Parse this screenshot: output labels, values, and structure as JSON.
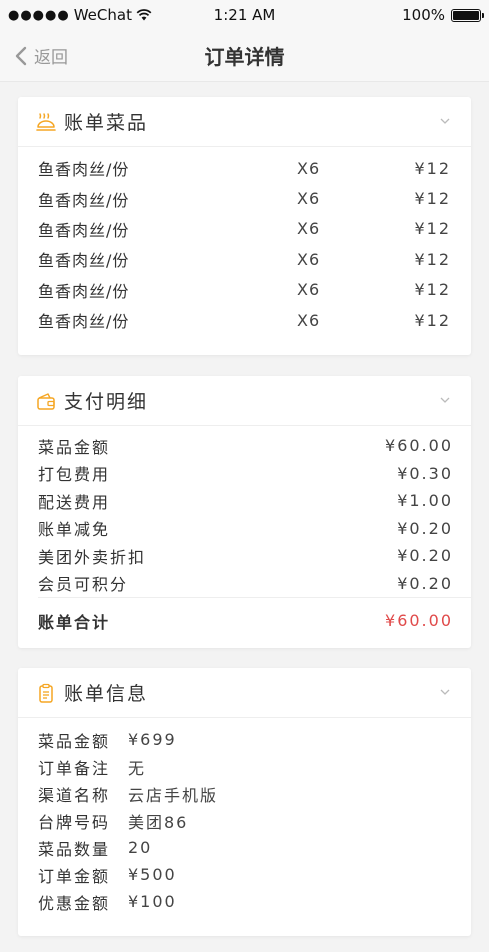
{
  "status_bar": {
    "carrier": "WeChat",
    "signal_dots": "●●●●●",
    "time": "1:21 AM",
    "battery": "100%",
    "battery_level": 1.0
  },
  "nav": {
    "back_label": "返回",
    "title": "订单详情"
  },
  "dishes_section": {
    "title": "账单菜品",
    "icon": "food-cloche-icon",
    "items": [
      {
        "name": "鱼香肉丝/份",
        "qty": "X6",
        "price": "¥12"
      },
      {
        "name": "鱼香肉丝/份",
        "qty": "X6",
        "price": "¥12"
      },
      {
        "name": "鱼香肉丝/份",
        "qty": "X6",
        "price": "¥12"
      },
      {
        "name": "鱼香肉丝/份",
        "qty": "X6",
        "price": "¥12"
      },
      {
        "name": "鱼香肉丝/份",
        "qty": "X6",
        "price": "¥12"
      },
      {
        "name": "鱼香肉丝/份",
        "qty": "X6",
        "price": "¥12"
      }
    ]
  },
  "payment_section": {
    "title": "支付明细",
    "icon": "wallet-icon",
    "rows": [
      {
        "label": "菜品金额",
        "value": "¥60.00"
      },
      {
        "label": "打包费用",
        "value": "¥0.30"
      },
      {
        "label": "配送费用",
        "value": "¥1.00"
      },
      {
        "label": "账单减免",
        "value": "¥0.20"
      },
      {
        "label": "美团外卖折扣",
        "value": "¥0.20"
      },
      {
        "label": "会员可积分",
        "value": "¥0.20"
      }
    ],
    "total_label": "账单合计",
    "total_value": "¥60.00"
  },
  "info_section": {
    "title": "账单信息",
    "icon": "clipboard-icon",
    "rows": [
      {
        "label": "菜品金额",
        "value": "¥699"
      },
      {
        "label": "订单备注",
        "value": "无"
      },
      {
        "label": "渠道名称",
        "value": "云店手机版"
      },
      {
        "label": "台牌号码",
        "value": "美团86"
      },
      {
        "label": "菜品数量",
        "value": "20"
      },
      {
        "label": "订单金额",
        "value": "¥500"
      },
      {
        "label": "优惠金额",
        "value": "¥100"
      }
    ]
  },
  "colors": {
    "accent": "#f5a623",
    "total_red": "#e04a4a",
    "background": "#f3f3f3"
  }
}
